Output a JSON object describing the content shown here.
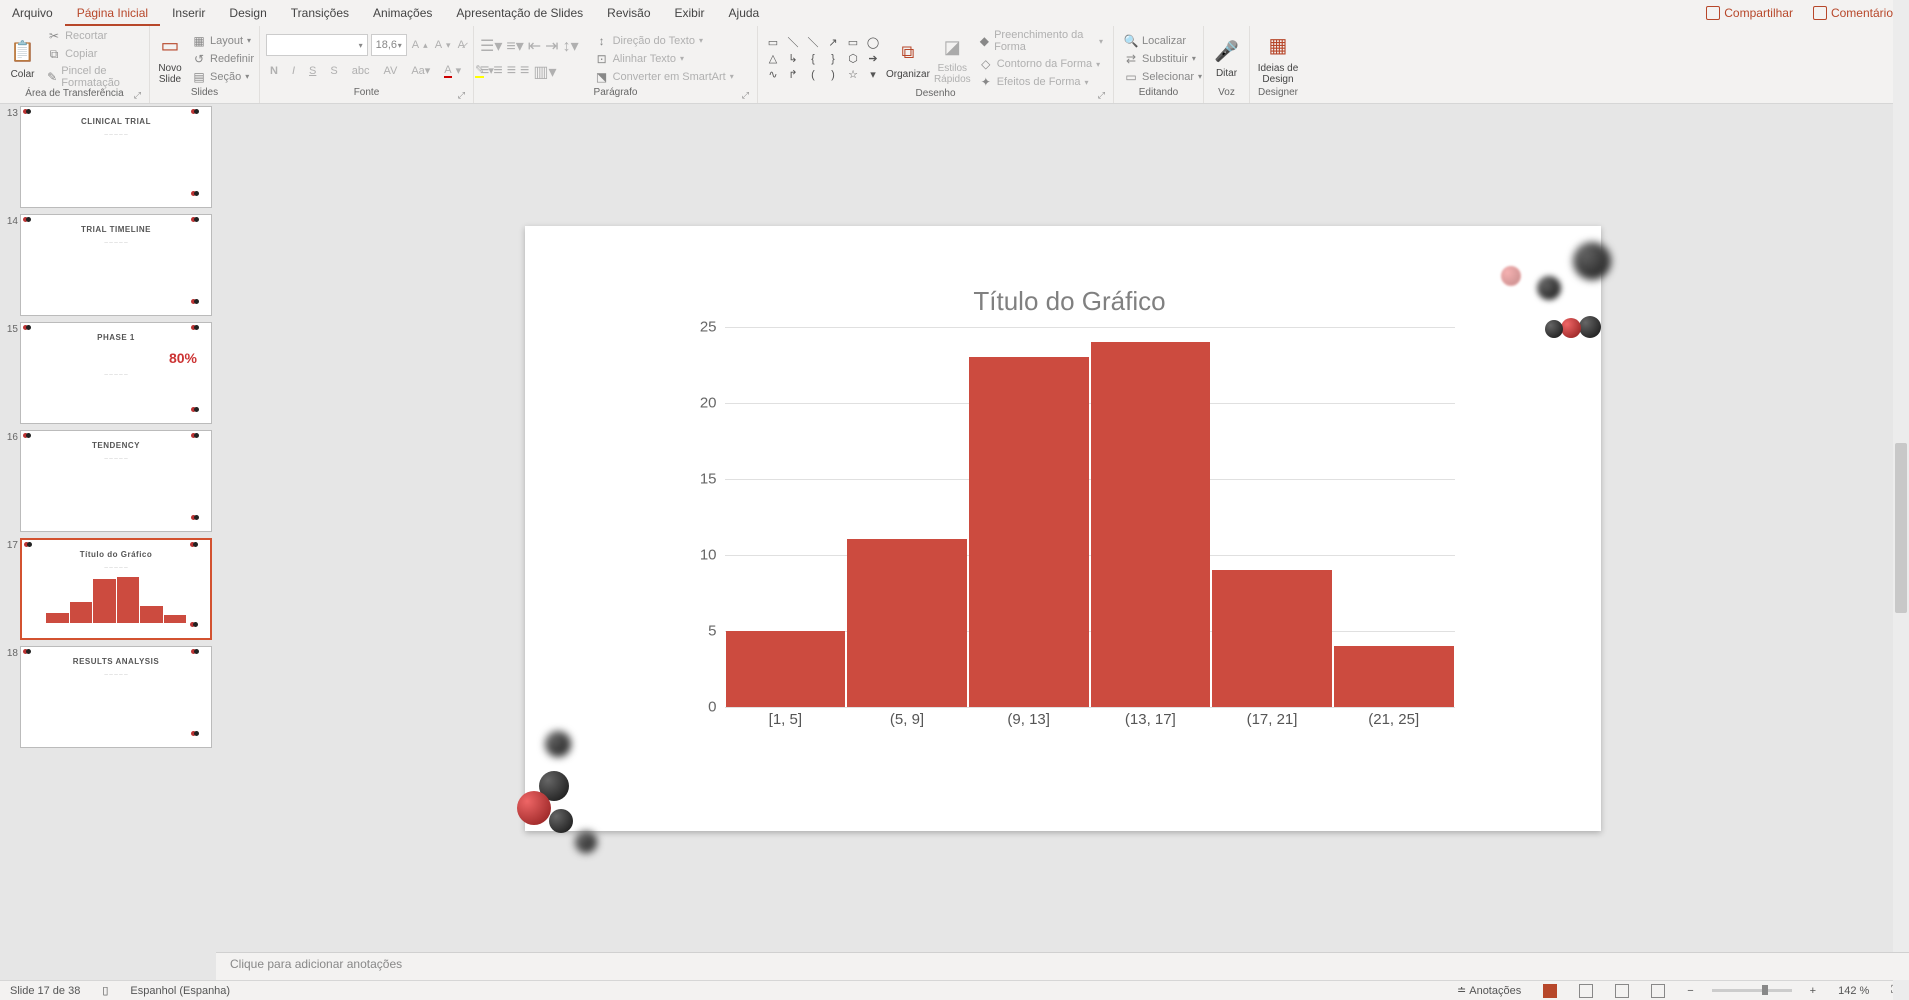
{
  "menu": {
    "tabs": [
      "Arquivo",
      "Página Inicial",
      "Inserir",
      "Design",
      "Transições",
      "Animações",
      "Apresentação de Slides",
      "Revisão",
      "Exibir",
      "Ajuda"
    ],
    "active_index": 1,
    "share": "Compartilhar",
    "comments": "Comentários"
  },
  "ribbon": {
    "clipboard": {
      "label": "Área de Transferência",
      "paste": "Colar",
      "cut": "Recortar",
      "copy": "Copiar",
      "format_painter": "Pincel de Formatação"
    },
    "slides": {
      "label": "Slides",
      "new_slide": "Novo Slide",
      "layout": "Layout",
      "reset": "Redefinir",
      "section": "Seção"
    },
    "font": {
      "label": "Fonte",
      "font_name_placeholder": "",
      "font_size": "18,6"
    },
    "paragraph": {
      "label": "Parágrafo",
      "text_direction": "Direção do Texto",
      "align_text": "Alinhar Texto",
      "convert_smartart": "Converter em SmartArt"
    },
    "drawing": {
      "label": "Desenho",
      "arrange": "Organizar",
      "quick_styles": "Estilos Rápidos",
      "shape_fill": "Preenchimento da Forma",
      "shape_outline": "Contorno da Forma",
      "shape_effects": "Efeitos de Forma"
    },
    "editing": {
      "label": "Editando",
      "find": "Localizar",
      "replace": "Substituir",
      "select": "Selecionar"
    },
    "voice": {
      "label": "Voz",
      "dictate": "Ditar"
    },
    "designer": {
      "label": "Designer",
      "ideas": "Ideias de Design"
    }
  },
  "thumbnails": [
    {
      "num": "13",
      "title": "CLINICAL TRIAL"
    },
    {
      "num": "14",
      "title": "TRIAL TIMELINE"
    },
    {
      "num": "15",
      "title": "PHASE 1",
      "extra": "80%"
    },
    {
      "num": "16",
      "title": "TENDENCY"
    },
    {
      "num": "17",
      "title": "Título do Gráfico",
      "selected": true
    },
    {
      "num": "18",
      "title": "RESULTS ANALYSIS"
    }
  ],
  "chart_data": {
    "type": "bar",
    "title": "Título do Gráfico",
    "categories": [
      "[1, 5]",
      "(5, 9]",
      "(9, 13]",
      "(13, 17]",
      "(17, 21]",
      "(21, 25]"
    ],
    "values": [
      5,
      11,
      23,
      24,
      9,
      4
    ],
    "ylim": [
      0,
      25
    ],
    "yticks": [
      0,
      5,
      10,
      15,
      20,
      25
    ],
    "xlabel": "",
    "ylabel": "",
    "color": "#cc4b3f"
  },
  "notes_placeholder": "Clique para adicionar anotações",
  "status": {
    "slide_counter": "Slide 17 de 38",
    "language": "Espanhol (Espanha)",
    "notes_btn": "Anotações",
    "zoom": "142 %"
  }
}
